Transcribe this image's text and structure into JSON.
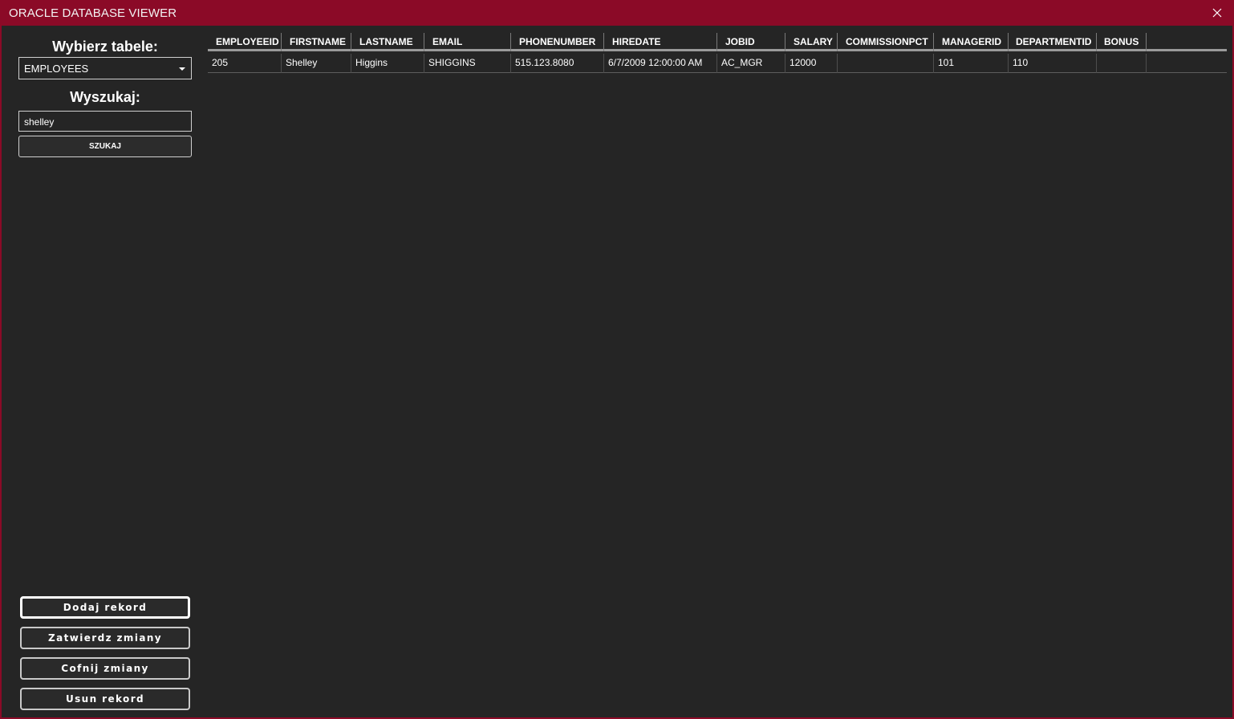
{
  "window": {
    "title": "ORACLE DATABASE VIEWER",
    "accent_color": "#8b0a27",
    "background_color": "#252525"
  },
  "sidebar": {
    "table_label": "Wybierz tabele:",
    "table_select": {
      "value": "EMPLOYEES"
    },
    "search_label": "Wyszukaj:",
    "search_input": {
      "value": "shelley"
    },
    "search_button": "SZUKAJ",
    "actions": {
      "add": "Dodaj rekord",
      "commit": "Zatwierdz zmiany",
      "revert": "Cofnij zmiany",
      "delete": "Usun rekord"
    }
  },
  "grid": {
    "columns": [
      "EMPLOYEEID",
      "FIRSTNAME",
      "LASTNAME",
      "EMAIL",
      "PHONENUMBER",
      "HIREDATE",
      "JOBID",
      "SALARY",
      "COMMISSIONPCT",
      "MANAGERID",
      "DEPARTMENTID",
      "BONUS"
    ],
    "rows": [
      [
        "205",
        "Shelley",
        "Higgins",
        "SHIGGINS",
        "515.123.8080",
        "6/7/2009 12:00:00 AM",
        "AC_MGR",
        "12000",
        "",
        "101",
        "110",
        ""
      ]
    ]
  }
}
